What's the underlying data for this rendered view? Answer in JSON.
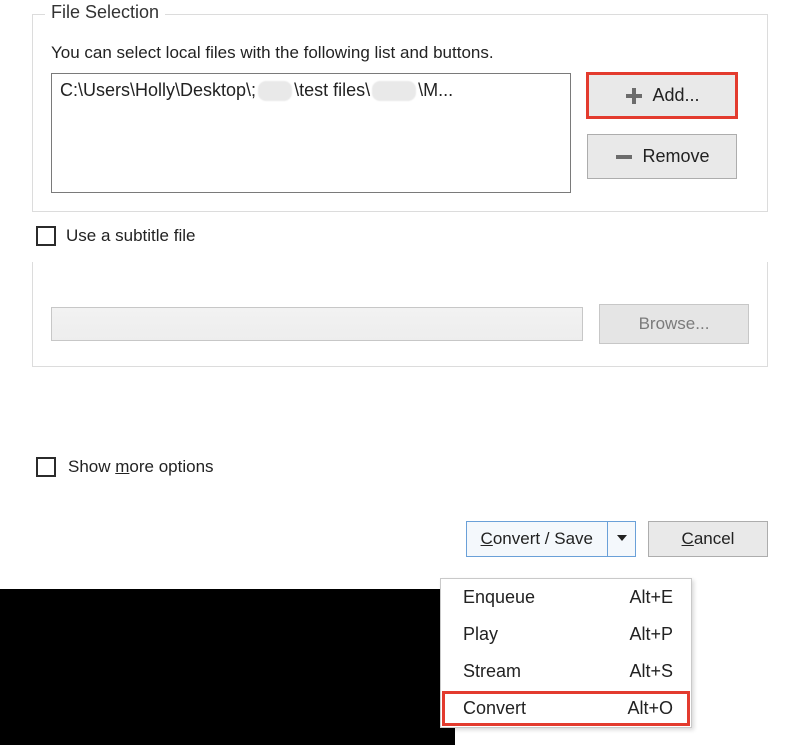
{
  "file_selection": {
    "title": "File Selection",
    "desc": "You can select local files with the following list and buttons.",
    "path_prefix": "C:\\Users\\Holly\\Desktop\\;",
    "path_mid": "\\test files\\",
    "path_tail": "\\M...",
    "add_label": "Add...",
    "remove_label": "Remove"
  },
  "subtitle": {
    "checkbox_label": "Use a subtitle file",
    "browse_label": "Browse..."
  },
  "show_more_pre": "Show ",
  "show_more_u": "m",
  "show_more_post": "ore options",
  "convert_save_pre": "",
  "convert_save_u": "C",
  "convert_save_post": "onvert / Save",
  "cancel_u": "C",
  "cancel_post": "ancel",
  "menu": {
    "item0": {
      "label": "Enqueue",
      "short": "Alt+E"
    },
    "item1": {
      "label": "Play",
      "short": "Alt+P"
    },
    "item2": {
      "label": "Stream",
      "short": "Alt+S"
    },
    "item3": {
      "label": "Convert",
      "short": "Alt+O"
    }
  }
}
